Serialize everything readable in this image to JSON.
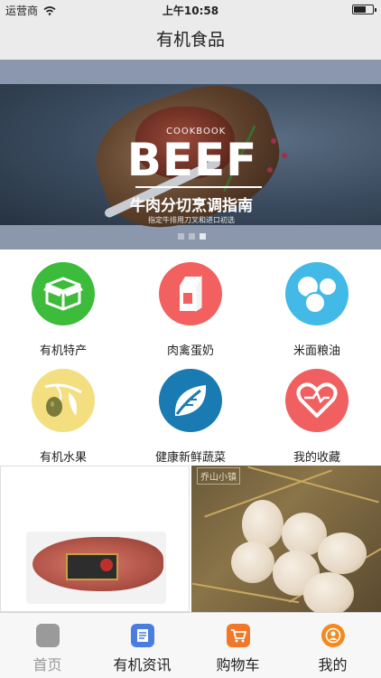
{
  "status_bar": {
    "carrier": "运营商",
    "time": "上午10:58"
  },
  "nav": {
    "title": "有机食品"
  },
  "banner": {
    "small_label": "COOKBOOK",
    "title": "BEEF",
    "subtitle": "牛肉分切烹调指南",
    "caption": "指定牛排用刀叉和进口初选",
    "page_count": 3,
    "active_page": 3
  },
  "categories": [
    {
      "label": "有机特产",
      "icon": "box-icon",
      "color": "#3dbb3a"
    },
    {
      "label": "肉禽蛋奶",
      "icon": "milk-carton-icon",
      "color": "#f26060"
    },
    {
      "label": "米面粮油",
      "icon": "grains-icon",
      "color": "#42b9e6"
    },
    {
      "label": "有机水果",
      "icon": "olive-icon",
      "color": "#f3de80"
    },
    {
      "label": "健康新鲜蔬菜",
      "icon": "leaf-icon",
      "color": "#1a7ab2"
    },
    {
      "label": "我的收藏",
      "icon": "heart-icon",
      "color": "#f06060"
    }
  ],
  "products": {
    "right_logo": "乔山小镇"
  },
  "tab_bar": {
    "tabs": [
      {
        "label": "首页",
        "icon": "home-icon",
        "color": "#999999",
        "label_color": "#999999"
      },
      {
        "label": "有机资讯",
        "icon": "news-icon",
        "color": "#4a7de0",
        "label_color": "#222222"
      },
      {
        "label": "购物车",
        "icon": "cart-icon",
        "color": "#f07828",
        "label_color": "#222222"
      },
      {
        "label": "我的",
        "icon": "profile-icon",
        "color": "#f28a20",
        "label_color": "#222222"
      }
    ]
  }
}
